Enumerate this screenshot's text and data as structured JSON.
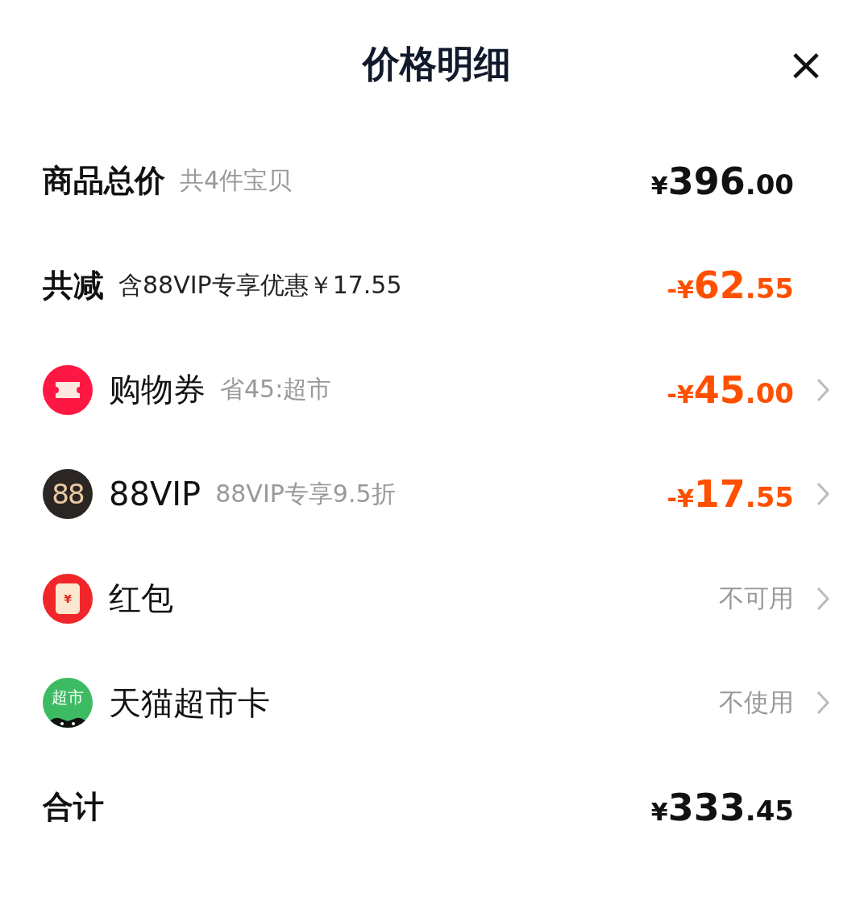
{
  "header": {
    "title": "价格明细",
    "close": "×"
  },
  "rows": [
    {
      "kind": "total",
      "label": "商品总价",
      "note": "共4件宝贝",
      "price": {
        "currency": "¥",
        "integer": "396",
        "decimal": ".00"
      }
    },
    {
      "kind": "reduction",
      "label": "共减",
      "note": "含88VIP专享优惠￥17.55",
      "price": {
        "sign": "-",
        "currency": "¥",
        "integer": "62",
        "decimal": ".55"
      }
    },
    {
      "kind": "coupon",
      "label": "购物券",
      "note": "省45:超市",
      "price": {
        "sign": "-",
        "currency": "¥",
        "integer": "45",
        "decimal": ".00"
      },
      "chevron": true
    },
    {
      "kind": "vip",
      "icon_text": "88",
      "label": "88VIP",
      "note": "88VIP专享9.5折",
      "price": {
        "sign": "-",
        "currency": "¥",
        "integer": "17",
        "decimal": ".55"
      },
      "chevron": true
    },
    {
      "kind": "envelope",
      "icon_text": "¥",
      "label": "红包",
      "status": "不可用",
      "chevron": true
    },
    {
      "kind": "card",
      "icon_text": "超市",
      "label": "天猫超市卡",
      "status": "不使用",
      "chevron": true
    },
    {
      "kind": "total",
      "label": "合计",
      "price": {
        "currency": "¥",
        "integer": "333",
        "decimal": ".45"
      }
    }
  ]
}
